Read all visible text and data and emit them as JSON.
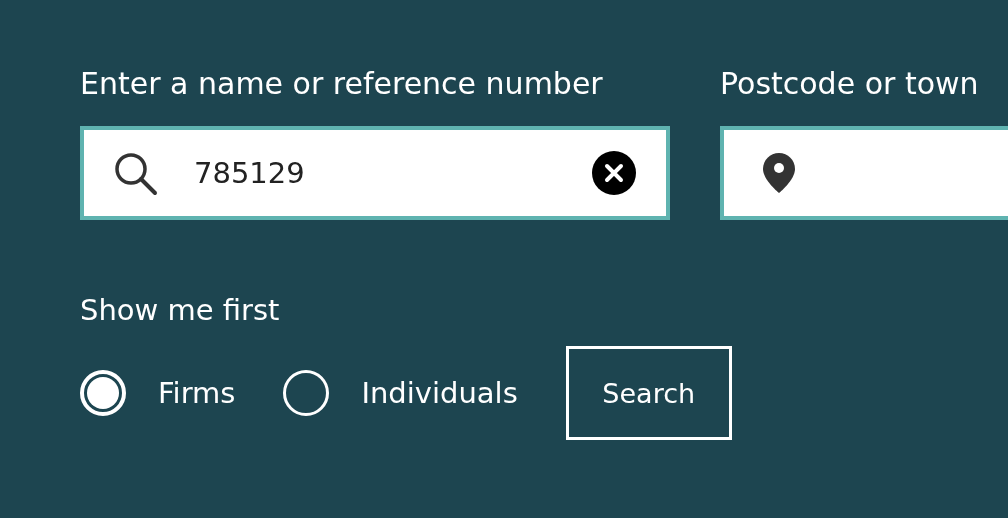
{
  "fields": [
    {
      "kind": "search",
      "label": "Enter a name or reference number",
      "value": "785129"
    },
    {
      "kind": "location",
      "label": "Postcode or town"
    }
  ],
  "show_first": {
    "label": "Show me first",
    "options": [
      {
        "label": "Firms",
        "selected": true
      },
      {
        "label": "Individuals",
        "selected": false
      }
    ]
  },
  "button": "Search"
}
